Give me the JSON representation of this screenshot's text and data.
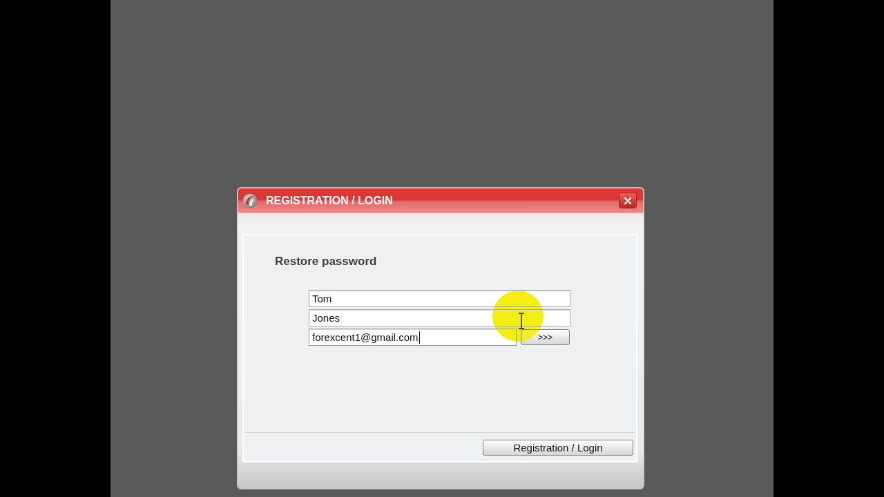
{
  "window": {
    "title": "REGISTRATION / LOGIN"
  },
  "form": {
    "heading": "Restore password",
    "fields": [
      {
        "value": "Tom",
        "focused": false
      },
      {
        "value": "Jones",
        "focused": false
      },
      {
        "value": "forexcent1@gmail.com",
        "focused": true,
        "button": ">>>"
      }
    ]
  },
  "footer": {
    "button": "Registration / Login"
  }
}
